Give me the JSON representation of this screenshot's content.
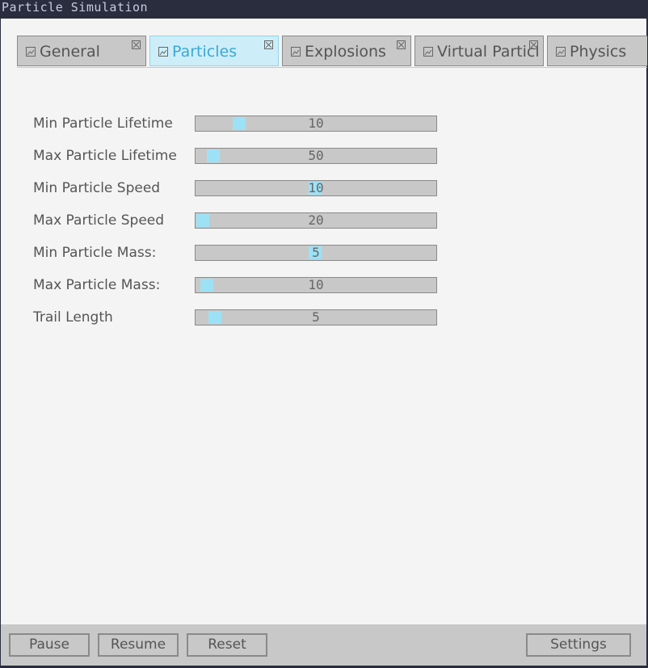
{
  "window": {
    "title": "Particle Simulation"
  },
  "tabs": [
    {
      "label": "General",
      "icon": "image-icon",
      "closable": true,
      "active": false
    },
    {
      "label": "Particles",
      "icon": "image-icon",
      "closable": true,
      "active": true
    },
    {
      "label": "Explosions",
      "icon": "image-icon",
      "closable": true,
      "active": false
    },
    {
      "label": "Virtual Particl",
      "icon": "image-icon",
      "closable": true,
      "active": false
    },
    {
      "label": "Physics",
      "icon": "image-icon",
      "closable": false,
      "active": false
    }
  ],
  "settings": [
    {
      "label": "Min Particle Lifetime",
      "value": "10"
    },
    {
      "label": "Max Particle Lifetime",
      "value": "50"
    },
    {
      "label": "Min Particle Speed",
      "value": "10"
    },
    {
      "label": "Max Particle Speed",
      "value": "20"
    },
    {
      "label": "Min Particle Mass:",
      "value": "5"
    },
    {
      "label": "Max Particle Mass:",
      "value": "10"
    },
    {
      "label": "Trail Length",
      "value": "5"
    }
  ],
  "buttons": {
    "pause": "Pause",
    "resume": "Resume",
    "reset": "Reset",
    "settings": "Settings"
  },
  "colors": {
    "accent": "#9de1f7",
    "active_tab": "#cdeef8",
    "control_bg": "#c8c8c8",
    "panel_bg": "#f4f4f4",
    "titlebar_bg": "#2a2d3e"
  }
}
